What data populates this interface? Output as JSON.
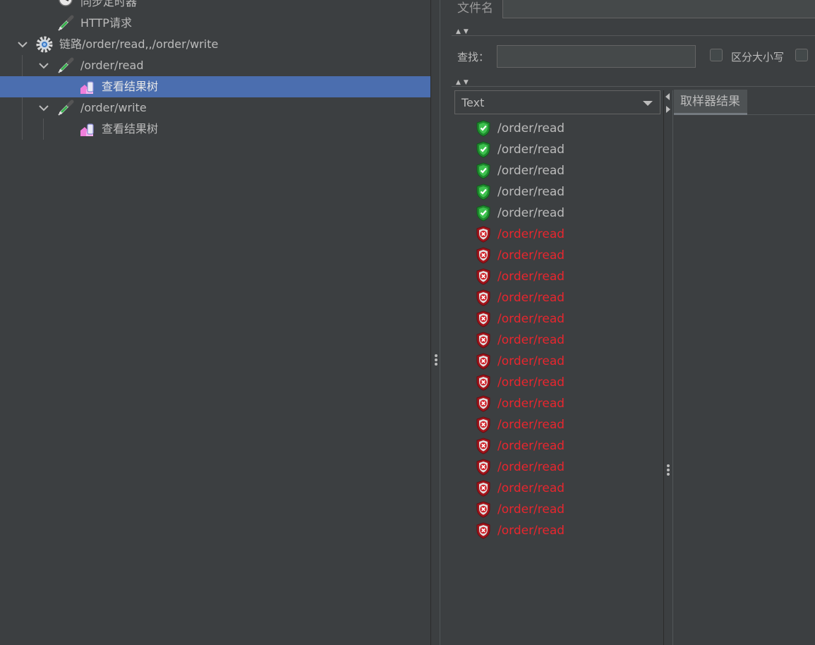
{
  "colors": {
    "background": "#3c3f41",
    "selection": "#4b6eaf",
    "text": "#bbbbbb",
    "success": "#bbbbbb",
    "failure": "#e8262e"
  },
  "tree": {
    "items": [
      {
        "label": "同步定时器",
        "icon": "timer-icon",
        "indent": 2,
        "expanded": null,
        "selected": false
      },
      {
        "label": "HTTP请求",
        "icon": "pipette-icon",
        "indent": 2,
        "expanded": null,
        "selected": false
      },
      {
        "label": "链路/order/read,,/order/write",
        "icon": "gear-icon",
        "indent": 1,
        "expanded": true,
        "selected": false
      },
      {
        "label": "/order/read",
        "icon": "pipette-icon",
        "indent": 2,
        "expanded": true,
        "selected": false
      },
      {
        "label": "查看结果树",
        "icon": "results-tree-icon",
        "indent": 3,
        "expanded": null,
        "selected": true
      },
      {
        "label": "/order/write",
        "icon": "pipette-icon",
        "indent": 2,
        "expanded": true,
        "selected": false
      },
      {
        "label": "查看结果树",
        "icon": "results-tree-icon",
        "indent": 3,
        "expanded": null,
        "selected": false
      }
    ]
  },
  "file": {
    "label": "文件名",
    "value": ""
  },
  "search": {
    "label": "查找：",
    "value": "",
    "case_sensitive_label": "区分大小写"
  },
  "renderer": {
    "selected": "Text"
  },
  "tabs": {
    "sampler_result": "取样器结果"
  },
  "results": [
    {
      "label": "/order/read",
      "status": "success"
    },
    {
      "label": "/order/read",
      "status": "success"
    },
    {
      "label": "/order/read",
      "status": "success"
    },
    {
      "label": "/order/read",
      "status": "success"
    },
    {
      "label": "/order/read",
      "status": "success"
    },
    {
      "label": "/order/read",
      "status": "failure"
    },
    {
      "label": "/order/read",
      "status": "failure"
    },
    {
      "label": "/order/read",
      "status": "failure"
    },
    {
      "label": "/order/read",
      "status": "failure"
    },
    {
      "label": "/order/read",
      "status": "failure"
    },
    {
      "label": "/order/read",
      "status": "failure"
    },
    {
      "label": "/order/read",
      "status": "failure"
    },
    {
      "label": "/order/read",
      "status": "failure"
    },
    {
      "label": "/order/read",
      "status": "failure"
    },
    {
      "label": "/order/read",
      "status": "failure"
    },
    {
      "label": "/order/read",
      "status": "failure"
    },
    {
      "label": "/order/read",
      "status": "failure"
    },
    {
      "label": "/order/read",
      "status": "failure"
    },
    {
      "label": "/order/read",
      "status": "failure"
    },
    {
      "label": "/order/read",
      "status": "failure"
    }
  ]
}
